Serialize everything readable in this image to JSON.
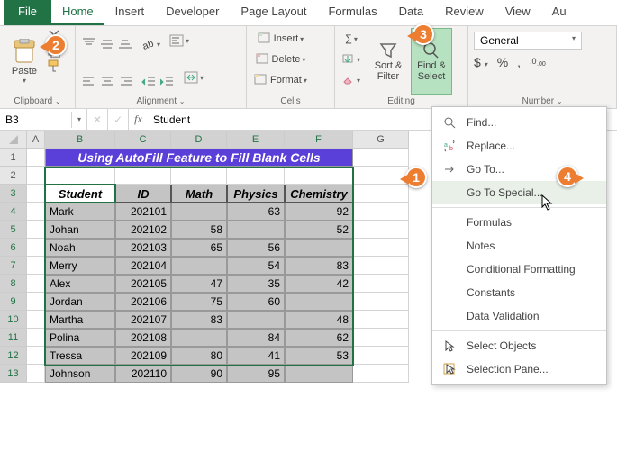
{
  "tabs": {
    "file": "File",
    "home": "Home",
    "insert": "Insert",
    "developer": "Developer",
    "pagelayout": "Page Layout",
    "formulas": "Formulas",
    "data": "Data",
    "review": "Review",
    "view": "View",
    "au": "Au"
  },
  "ribbon": {
    "paste": "Paste",
    "clipboard": "Clipboard",
    "alignment": "Alignment",
    "insert": "Insert",
    "delete": "Delete",
    "format": "Format",
    "cells": "Cells",
    "sortfilter": "Sort &\nFilter",
    "findselect": "Find &\nSelect",
    "editing": "Editing",
    "general": "General",
    "number": "Number",
    "currency": "$",
    "percent": "%",
    "comma": ","
  },
  "namebox": "B3",
  "formula": "Student",
  "columns": [
    "A",
    "B",
    "C",
    "D",
    "E",
    "F",
    "G"
  ],
  "row_start": 1,
  "row_end": 13,
  "banner": "Using AutoFill Feature to Fill Blank Cells",
  "headers": {
    "student": "Student",
    "id": "ID",
    "math": "Math",
    "physics": "Physics",
    "chemistry": "Chemistry"
  },
  "chart_data": {
    "type": "table",
    "columns": [
      "Student",
      "ID",
      "Math",
      "Physics",
      "Chemistry"
    ],
    "rows": [
      [
        "Mark",
        "202101",
        "",
        "63",
        "92"
      ],
      [
        "Johan",
        "202102",
        "58",
        "",
        "52"
      ],
      [
        "Noah",
        "202103",
        "65",
        "56",
        ""
      ],
      [
        "Merry",
        "202104",
        "",
        "54",
        "83"
      ],
      [
        "Alex",
        "202105",
        "47",
        "35",
        "42"
      ],
      [
        "Jordan",
        "202106",
        "75",
        "60",
        ""
      ],
      [
        "Martha",
        "202107",
        "83",
        "",
        "48"
      ],
      [
        "Polina",
        "202108",
        "",
        "84",
        "62"
      ],
      [
        "Tressa",
        "202109",
        "80",
        "41",
        "53"
      ],
      [
        "Johnson",
        "202110",
        "90",
        "95",
        ""
      ]
    ]
  },
  "dropdown": {
    "find": "Find...",
    "replace": "Replace...",
    "goto": "Go To...",
    "gotospecial": "Go To Special...",
    "formulas": "Formulas",
    "notes": "Notes",
    "condfmt": "Conditional Formatting",
    "constants": "Constants",
    "datavalid": "Data Validation",
    "selectobj": "Select Objects",
    "selpane": "Selection Pane..."
  },
  "markers": {
    "m1": "1",
    "m2": "2",
    "m3": "3",
    "m4": "4"
  }
}
